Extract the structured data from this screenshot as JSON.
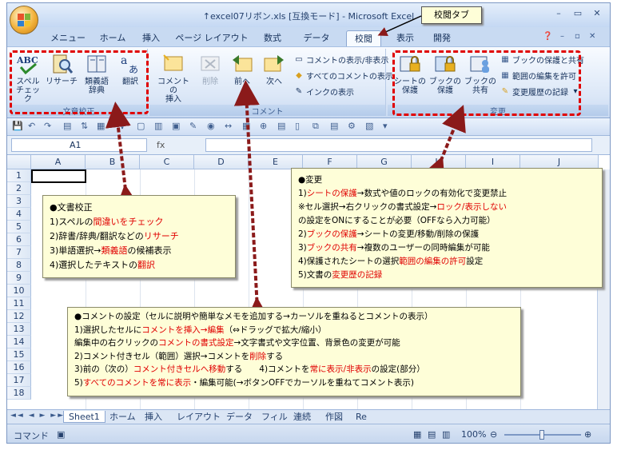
{
  "window": {
    "title": "↑excel07リボン.xls  [互換モード] - Microsoft Excel"
  },
  "ribbon_tabs": [
    "メニュー",
    "ホーム",
    "挿入",
    "ページ レイアウト",
    "数式",
    "データ",
    "校閲",
    "表示",
    "開発"
  ],
  "active_tab": "校閲",
  "groups": {
    "proofing": {
      "title": "文章校正",
      "buttons": [
        {
          "label1": "スペル",
          "label2": "チェック"
        },
        {
          "label1": "リサーチ",
          "label2": ""
        },
        {
          "label1": "類義語",
          "label2": "辞典"
        },
        {
          "label1": "翻訳",
          "label2": ""
        }
      ]
    },
    "comments": {
      "title": "コメント",
      "buttons": [
        {
          "label1": "コメントの",
          "label2": "挿入"
        },
        {
          "label1": "削除",
          "label2": ""
        },
        {
          "label1": "前へ",
          "label2": ""
        },
        {
          "label1": "次へ",
          "label2": ""
        }
      ],
      "small": [
        "コメントの表示/非表示",
        "すべてのコメントの表示",
        "インクの表示"
      ]
    },
    "changes": {
      "title": "変更",
      "buttons": [
        {
          "label1": "シートの",
          "label2": "保護"
        },
        {
          "label1": "ブックの",
          "label2": "保護"
        },
        {
          "label1": "ブックの",
          "label2": "共有"
        }
      ],
      "small": [
        "ブックの保護と共有",
        "範囲の編集を許可",
        "変更履歴の記録"
      ]
    }
  },
  "formula_bar": {
    "name_box": "A1",
    "fx": "fx"
  },
  "columns": [
    "A",
    "B",
    "C",
    "D",
    "E",
    "F",
    "G",
    "H",
    "I",
    "J"
  ],
  "rows": [
    "1",
    "2",
    "3",
    "4",
    "5",
    "6",
    "7",
    "8",
    "9",
    "10",
    "11",
    "12",
    "13",
    "14",
    "15",
    "16",
    "17",
    "18"
  ],
  "sheet_tabs": [
    "Sheet1",
    "ホーム",
    "挿入",
    "レイアウト",
    "データ",
    "フィル",
    "連続",
    "作図",
    "Re"
  ],
  "status": {
    "mode": "コマンド",
    "zoom": "100%"
  },
  "annotations": {
    "tab_label": "校閲タブ",
    "proofing": {
      "title": "●文書校正",
      "l1a": "1)スペルの",
      "l1b": "間違いをチェック",
      "l2a": "2)辞書/辞典/翻訳などの",
      "l2b": "リサーチ",
      "l3a": "3)単語選択→",
      "l3b": "類義語",
      "l3c": "の候補表示",
      "l4a": "4)選択したテキストの",
      "l4b": "翻訳"
    },
    "changes": {
      "title": "●変更",
      "l1a": "1)",
      "l1b": "シートの保護",
      "l1c": "→数式や値のロックの有効化で変更禁止",
      "l2a": "※セル選択→右クリックの書式設定→",
      "l2b": "ロック/表示しない",
      "l3": "の設定をONにすることが必要（OFFなら入力可能）",
      "l4a": "2)",
      "l4b": "ブックの保護",
      "l4c": "→シートの変更/移動/削除の保護",
      "l5a": "3)",
      "l5b": "ブックの共有",
      "l5c": "→複数のユーザーの同時編集が可能",
      "l6a": "4)保護されたシートの選択",
      "l6b": "範囲の編集の許可",
      "l6c": "設定",
      "l7a": "5)文書の",
      "l7b": "変更歴の記録"
    },
    "comments": {
      "title": "●コメントの設定（セルに説明や簡単なメモを追加する→カーソルを重ねるとコメントの表示）",
      "l1a": "1)選択したセルに",
      "l1b": "コメントを挿入→編集",
      "l1c": "（⇔ドラッグで拡大/縮小）",
      "l2a": "編集中の右クリックの",
      "l2b": "コメントの書式設定",
      "l2c": "→文字書式や文字位置、背景色の変更が可能",
      "l3a": "2)コメント付きセル（範囲）選択→コメントを",
      "l3b": "削除",
      "l3c": "する",
      "l4a": "3)前の（次の）",
      "l4b": "コメント付きセルへ移動",
      "l4c": "する　　4)コメントを",
      "l4d": "常に表示/非表示",
      "l4e": "の設定(部分）",
      "l5a": "5)",
      "l5b": "すべてのコメントを常に表示",
      "l5c": "・編集可能(→ボタンOFFでカーソルを重ねてコメント表示)"
    }
  }
}
